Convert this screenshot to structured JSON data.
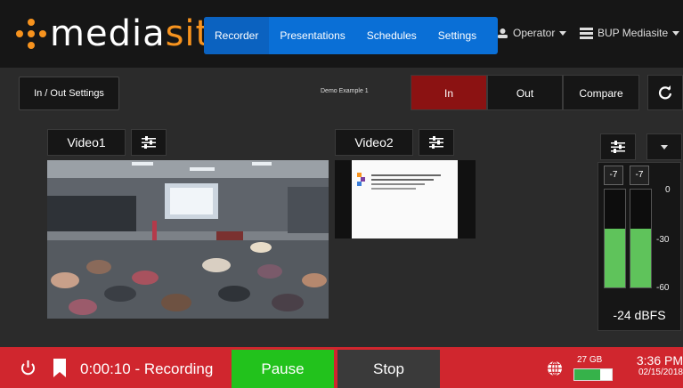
{
  "header": {
    "logo_text_a": "media",
    "logo_text_b": "sit",
    "nav": [
      {
        "label": "Recorder",
        "active": true
      },
      {
        "label": "Presentations"
      },
      {
        "label": "Schedules"
      },
      {
        "label": "Settings"
      }
    ],
    "operator": "Operator",
    "site": "BUP Mediasite"
  },
  "toolbar": {
    "io_settings": "In / Out Settings",
    "demo_label": "Demo Example 1",
    "tabs": {
      "in": "In",
      "out": "Out",
      "compare": "Compare"
    }
  },
  "video1": {
    "label": "Video1"
  },
  "video2": {
    "label": "Video2"
  },
  "audio": {
    "left_peak": "-7",
    "right_peak": "-7",
    "scale": [
      "0",
      "-30",
      "-60"
    ],
    "level_fraction": 0.6,
    "dbfs": "-24 dBFS"
  },
  "status": {
    "recording": "0:00:10 - Recording",
    "pause": "Pause",
    "stop": "Stop",
    "disk": "27 GB",
    "disk_fraction": 0.7,
    "time": "3:36 PM",
    "date": "02/15/2018"
  },
  "colors": {
    "brand": "#f7931e",
    "nav": "#0a6fd6",
    "recording_bar": "#d0262e",
    "pause": "#22c21c",
    "in_tab": "#8b1212",
    "meter": "#5fc35b"
  }
}
